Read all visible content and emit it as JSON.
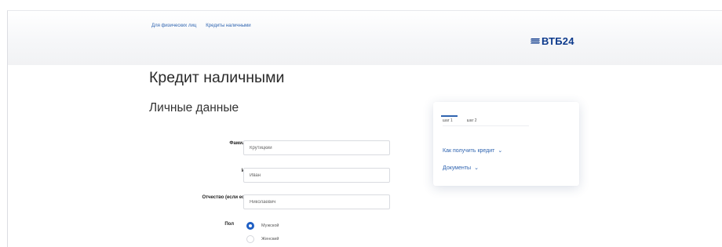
{
  "breadcrumb": {
    "items": [
      "Для физических лиц",
      "Кредиты наличными"
    ]
  },
  "logo": {
    "text": "ВТБ",
    "number": "24"
  },
  "page": {
    "title": "Кредит наличными",
    "section_title": "Личные данные"
  },
  "form": {
    "last_name": {
      "label": "Фамилия",
      "value": "Крутицкий"
    },
    "first_name": {
      "label": "Имя",
      "value": "Иван"
    },
    "patronymic": {
      "label": "Отчество (если есть)",
      "value": "Николаевич"
    },
    "gender": {
      "label": "Пол",
      "options": [
        "Мужской",
        "Женский"
      ],
      "selected": "Мужской"
    }
  },
  "sidebar_card": {
    "steps": [
      "шаг 1",
      "шаг 2"
    ],
    "links": [
      "Как получить кредит",
      "Документы"
    ],
    "chevron_glyph": "⌄"
  },
  "colors": {
    "accent": "#2f64b0",
    "brand": "#0d3a8c",
    "radio": "#1f5fc4"
  }
}
